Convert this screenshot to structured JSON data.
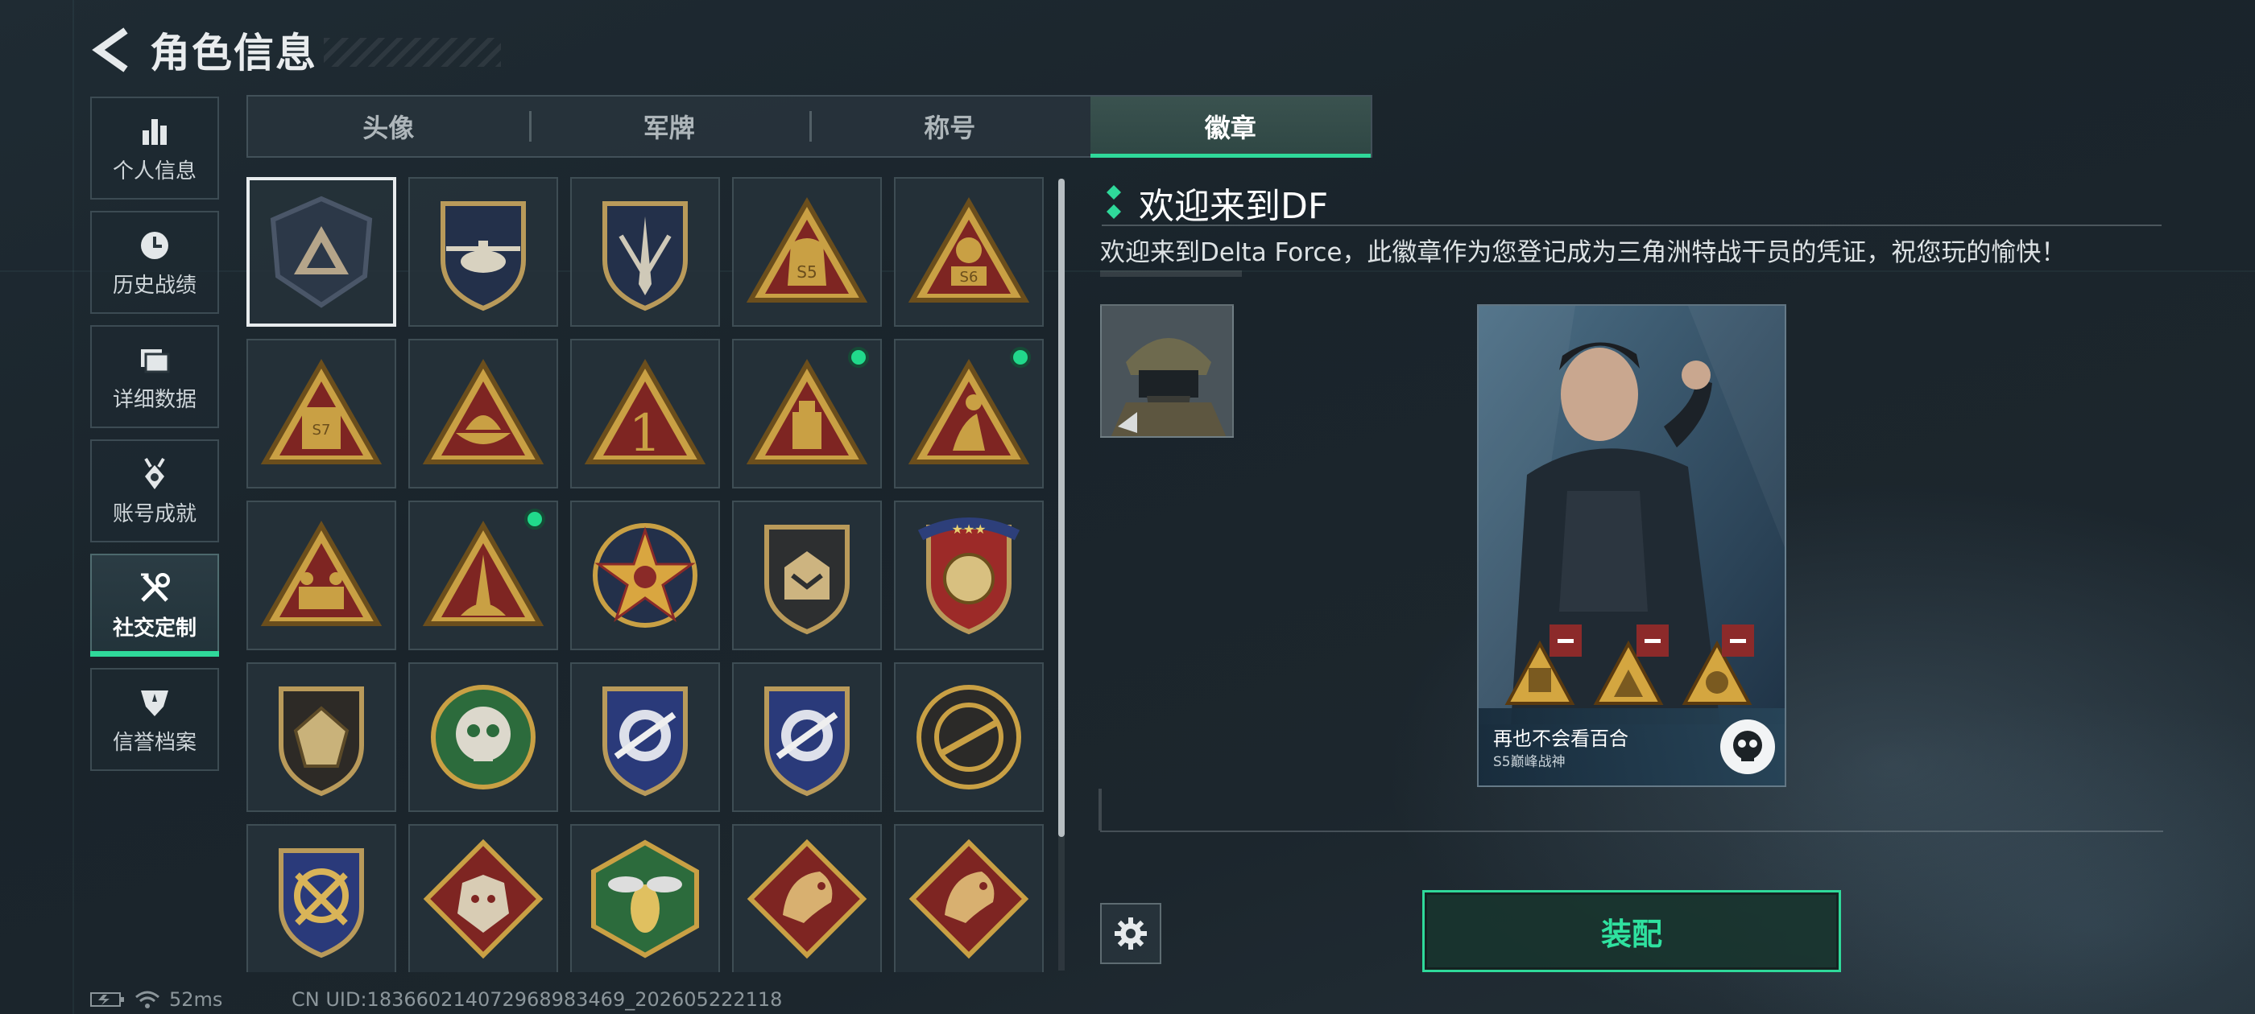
{
  "header": {
    "title": "角色信息"
  },
  "sidebar": {
    "items": [
      {
        "label": "个人信息",
        "icon": "bar-chart-icon"
      },
      {
        "label": "历史战绩",
        "icon": "clock-history-icon"
      },
      {
        "label": "详细数据",
        "icon": "folder-icon"
      },
      {
        "label": "账号成就",
        "icon": "medal-icon"
      },
      {
        "label": "社交定制",
        "icon": "tools-icon",
        "active": true
      },
      {
        "label": "信誉档案",
        "icon": "shield-star-icon"
      }
    ]
  },
  "tabs": [
    {
      "label": "头像"
    },
    {
      "label": "军牌"
    },
    {
      "label": "称号"
    },
    {
      "label": "徽章",
      "active": true
    }
  ],
  "badges": {
    "count": 25,
    "selected_index": 0,
    "new_indicator_indices": [
      8,
      9,
      11
    ],
    "icons": [
      "delta-triangle-badge-icon",
      "helicopter-badge-icon",
      "dagger-badge-icon",
      "s5-bag-badge-icon",
      "s6-badge-icon",
      "s7-badge-icon",
      "boat-badge-icon",
      "number-one-badge-icon",
      "usb-badge-icon",
      "player-badge-icon",
      "squad-badge-icon",
      "rocket-badge-icon",
      "star-compass-badge-icon",
      "winged-shield-badge-icon",
      "stars-shield-badge-icon",
      "dice-shield-badge-icon",
      "skull-badge-icon",
      "crosshair-rifle-badge-icon",
      "crosshair-rifle-badge-icon-2",
      "rifle-ring-badge-icon",
      "crossed-sabers-badge-icon",
      "wolf-badge-icon",
      "wasp-badge-icon",
      "dragon-badge-icon",
      "dragon-badge-icon-2"
    ]
  },
  "detail": {
    "title": "欢迎来到DF",
    "description": "欢迎来到Delta Force，此徽章作为您登记成为三角洲特战干员的凭证，祝您玩的愉快！"
  },
  "card": {
    "name": "再也不会看百合",
    "subtitle": "S5巅峰战神"
  },
  "actions": {
    "equip_label": "装配"
  },
  "status": {
    "ping": "52ms",
    "uid": "CN UID:1836602140729689834​69_202605222118"
  },
  "colors": {
    "accent": "#2fd99a",
    "dot": "#21d98b"
  }
}
